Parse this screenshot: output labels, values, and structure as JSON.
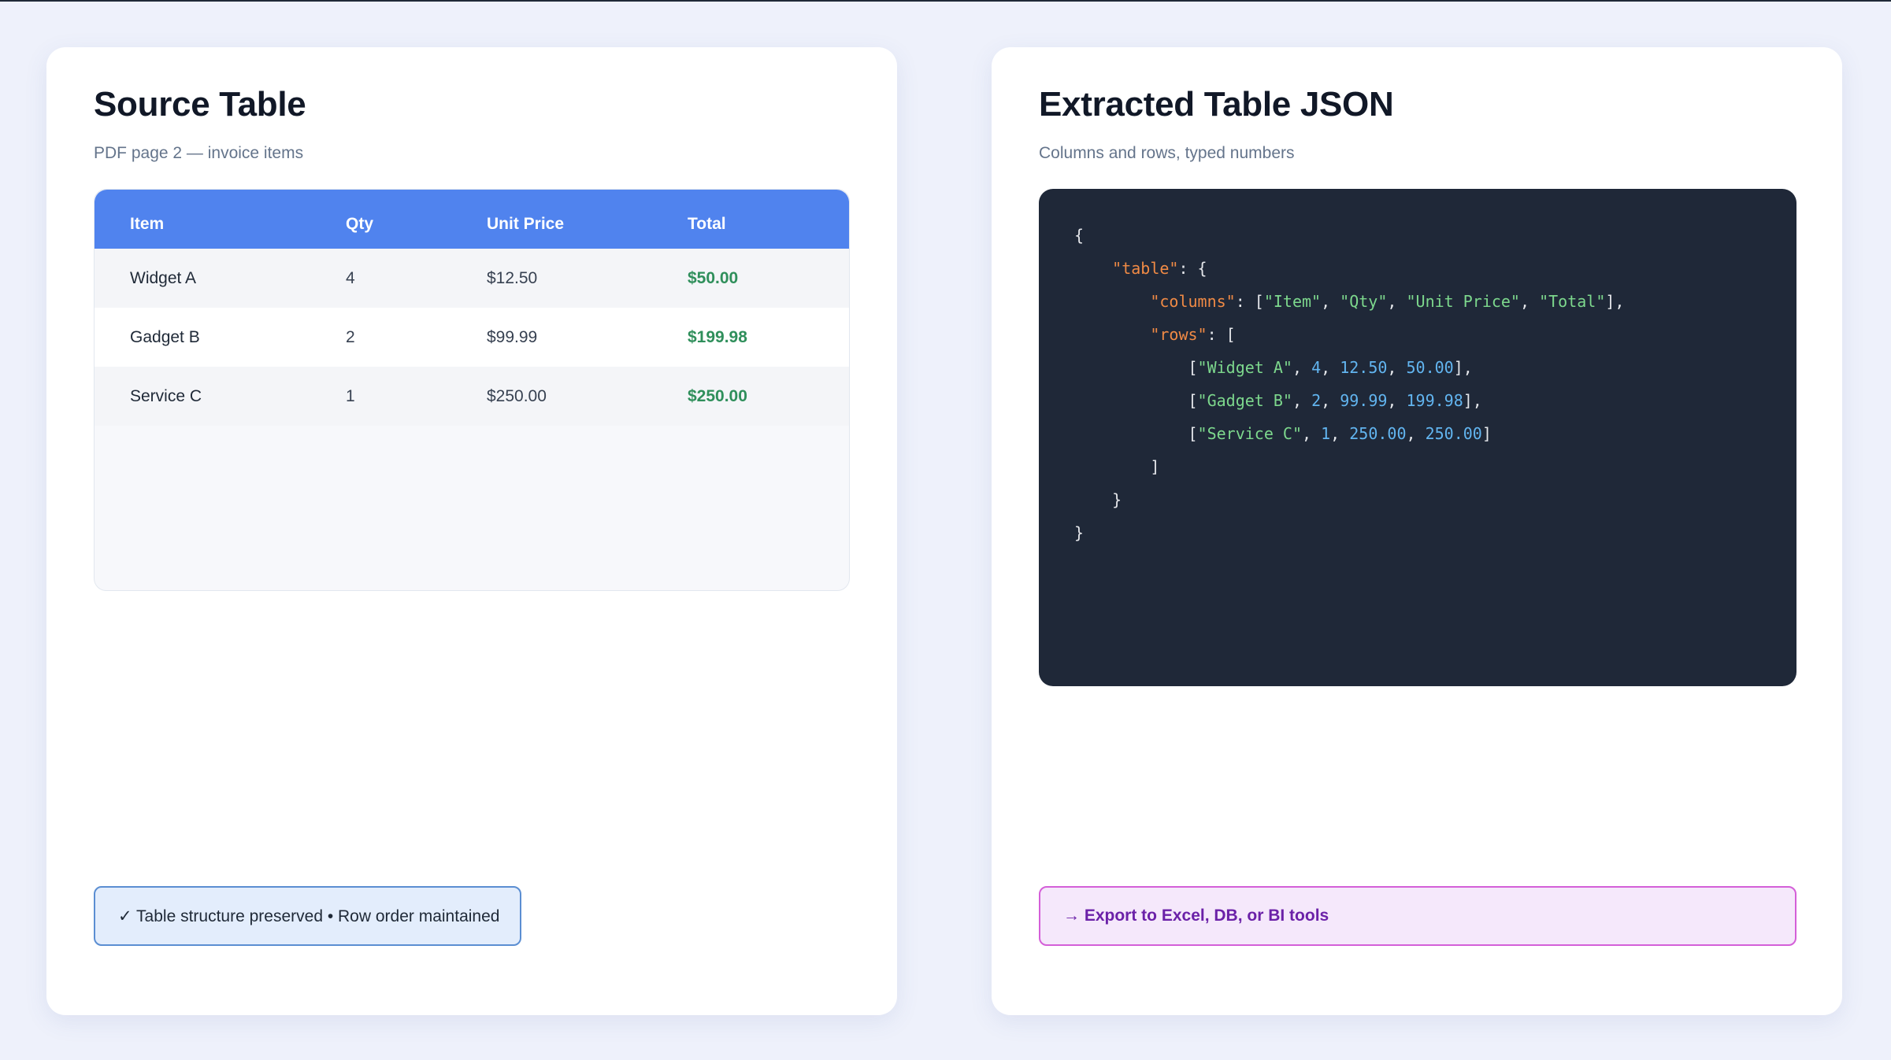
{
  "left_panel": {
    "title": "Source Table",
    "subtitle": "PDF page 2 — invoice items",
    "table": {
      "headers": [
        "Item",
        "Qty",
        "Unit Price",
        "Total"
      ],
      "rows": [
        [
          "Widget A",
          "4",
          "$12.50",
          "$50.00"
        ],
        [
          "Gadget B",
          "2",
          "$99.99",
          "$199.98"
        ],
        [
          "Service C",
          "1",
          "$250.00",
          "$250.00"
        ]
      ]
    },
    "badge": "✓ Table structure preserved • Row order maintained"
  },
  "right_panel": {
    "title": "Extracted Table JSON",
    "subtitle": "Columns and rows, typed numbers",
    "json_lines": [
      "{",
      "  \"table\": {",
      "    \"columns\": [\"Item\", \"Qty\", \"Unit Price\", \"Total\"],",
      "    \"rows\": [",
      "      [\"Widget A\", 4, 12.50, 50.00],",
      "      [\"Gadget B\", 2, 99.99, 199.98],",
      "      [\"Service C\", 1, 250.00, 250.00]",
      "    ]",
      "  }",
      "}"
    ],
    "badge": "→ Export to Excel, DB, or BI tools"
  },
  "colors": {
    "background": "#eef1fb",
    "table_header": "#5083ee",
    "total_green": "#2f8f5b",
    "code_bg": "#1f2838",
    "json_key": "#f08a45",
    "json_string": "#7dd88d",
    "json_number": "#62b5f0",
    "badge_blue_border": "#5b8ed2",
    "badge_purple_border": "#d45fd8"
  }
}
